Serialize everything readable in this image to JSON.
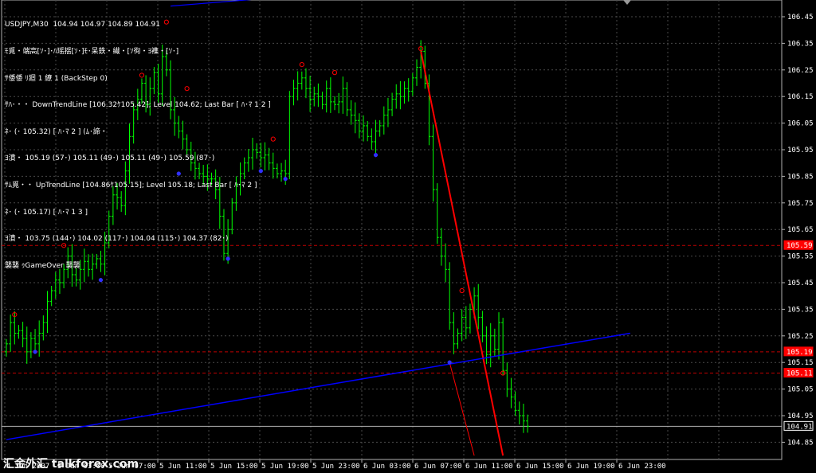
{
  "header": {
    "symbol_line": "USDJPY,M30  104.94 104.97 104.89 104.91",
    "lines": [
      "ﾓ覓・端高[ｿ･]･ﾊ瑶揺[ｿ･]ﾓ･呆鉄・繊・[ｿ徇・ﾖ襍・[ｿ･]",
      "ｻ倭倭 ﾘ廻 1 繚 1 (BackStep 0)",
      "ｻﾊ･・・ DownTrendLine [106.32ｹ105.42]; Level 104.62; Last Bar [ ﾊ･ﾏ 1 2 ]",
      "ﾈ･ (･ 105.32) [ ﾊ･ﾏ 2 ] (ﾑ･諦・",
      "ﾖ濆・ 105.19 (57･) 105.11 (49･) 105.11 (49･) 105.59 (87･)",
      "ｻﾑ覓・・ UpTrendLine [104.86ｹ105.15]; Level 105.18; Last Bar [ ﾊ･ﾏ 2 ]",
      "ﾈ･ (･ 105.17) [ ﾊ･ﾏ 1 3 ]",
      "ﾖ濆・ 103.75 (144･) 104.02 (117･) 104.04 (115･) 104.37 (82･)",
      "襲襲 ｩGameOver 襲襲"
    ]
  },
  "watermark": "汇金外汇 talkforex.com",
  "chart_data": {
    "type": "candlestick",
    "symbol": "USDJPY",
    "timeframe": "M30",
    "ylim": [
      104.8,
      106.5
    ],
    "y_ticks": [
      "106.45",
      "106.35",
      "106.25",
      "106.15",
      "106.05",
      "105.95",
      "105.85",
      "105.75",
      "105.65",
      "105.55",
      "105.45",
      "105.35",
      "105.25",
      "105.15",
      "105.05",
      "104.95",
      "104.85"
    ],
    "x_ticks": [
      "4 Jun 2007",
      "5 Jun 03:00",
      "5 Jun 07:00",
      "5 Jun 11:00",
      "5 Jun 15:00",
      "5 Jun 19:00",
      "5 Jun 23:00",
      "6 Jun 03:00",
      "6 Jun 07:00",
      "6 Jun 11:00",
      "6 Jun 15:00",
      "6 Jun 19:00",
      "6 Jun 23:00"
    ],
    "grid": true,
    "price_labels": [
      {
        "value": 105.59,
        "text": "105.59",
        "color": "#ff0000"
      },
      {
        "value": 105.19,
        "text": "105.19",
        "color": "#ff0000"
      },
      {
        "value": 105.11,
        "text": "105.11",
        "color": "#ff0000"
      },
      {
        "value": 104.91,
        "text": "104.91",
        "color": "#ffffff"
      }
    ],
    "closes": [
      105.22,
      105.3,
      105.26,
      105.27,
      105.24,
      105.19,
      105.24,
      105.22,
      105.26,
      105.3,
      105.38,
      105.42,
      105.46,
      105.45,
      105.5,
      105.55,
      105.48,
      105.46,
      105.5,
      105.53,
      105.5,
      105.52,
      105.54,
      105.52,
      105.6,
      105.7,
      105.78,
      105.77,
      105.74,
      105.87,
      106.0,
      106.1,
      106.14,
      106.2,
      106.12,
      106.18,
      106.24,
      106.16,
      106.3,
      106.25,
      106.1,
      106.05,
      106.02,
      105.99,
      105.95,
      105.9,
      105.88,
      105.86,
      105.85,
      105.84,
      105.84,
      105.8,
      105.7,
      105.56,
      105.65,
      105.75,
      105.82,
      105.86,
      105.9,
      105.92,
      105.95,
      105.94,
      105.92,
      105.93,
      105.9,
      105.88,
      105.86,
      105.87,
      105.86,
      106.15,
      106.18,
      106.2,
      106.22,
      106.18,
      106.14,
      106.16,
      106.15,
      106.12,
      106.18,
      106.13,
      106.12,
      106.13,
      106.18,
      106.1,
      106.08,
      106.06,
      106.02,
      106.04,
      106.0,
      105.98,
      106.02,
      106.04,
      106.08,
      106.1,
      106.14,
      106.16,
      106.15,
      106.18,
      106.17,
      106.22,
      106.26,
      106.32,
      106.2,
      106.0,
      105.8,
      105.62,
      105.55,
      105.5,
      105.3,
      105.22,
      105.26,
      105.32,
      105.28,
      105.35,
      105.4,
      105.32,
      105.25,
      105.18,
      105.25,
      105.2,
      105.3,
      105.12,
      105.05,
      105.02,
      104.97,
      104.95,
      104.93,
      104.91
    ],
    "swing_highs": [
      {
        "i": 2,
        "v": 105.33
      },
      {
        "i": 14,
        "v": 105.59
      },
      {
        "i": 33,
        "v": 106.23
      },
      {
        "i": 39,
        "v": 106.43
      },
      {
        "i": 44,
        "v": 106.18
      },
      {
        "i": 65,
        "v": 105.99
      },
      {
        "i": 72,
        "v": 106.27
      },
      {
        "i": 80,
        "v": 106.24
      },
      {
        "i": 101,
        "v": 106.33
      },
      {
        "i": 111,
        "v": 105.42
      },
      {
        "i": 121,
        "v": 105.11
      }
    ],
    "swing_lows": [
      {
        "i": 7,
        "v": 105.19
      },
      {
        "i": 23,
        "v": 105.46
      },
      {
        "i": 42,
        "v": 105.86
      },
      {
        "i": 54,
        "v": 105.54
      },
      {
        "i": 62,
        "v": 105.87
      },
      {
        "i": 68,
        "v": 105.84
      },
      {
        "i": 90,
        "v": 105.93
      },
      {
        "i": 108,
        "v": 105.15
      }
    ],
    "lines": [
      {
        "name": "DownTrendLine",
        "color": "#ff0000",
        "width": 2,
        "points": [
          [
            101,
            106.32
          ],
          [
            121,
            104.8
          ]
        ]
      },
      {
        "name": "DownTrendLine-thin",
        "color": "#ff0000",
        "width": 1,
        "points": [
          [
            108,
            105.15
          ],
          [
            114,
            104.8
          ]
        ]
      },
      {
        "name": "UpTrendLine",
        "color": "#0000ff",
        "width": 1.5,
        "points": [
          [
            0,
            104.86
          ],
          [
            152,
            105.26
          ]
        ]
      },
      {
        "name": "UpTrendLine-upper",
        "color": "#0000ff",
        "width": 1.2,
        "points": [
          [
            40,
            106.49
          ],
          [
            72,
            106.53
          ]
        ]
      }
    ],
    "hlines": [
      {
        "value": 105.59,
        "color": "#c00000",
        "dash": "4,3"
      },
      {
        "value": 105.19,
        "color": "#c00000",
        "dash": "4,3"
      },
      {
        "value": 105.11,
        "color": "#c00000",
        "dash": "4,3"
      },
      {
        "value": 104.91,
        "color": "#b0b0b0",
        "dash": ""
      }
    ],
    "colors": {
      "background": "#000000",
      "grid": "#4a4a4a",
      "bars": "#00ff00",
      "axis": "#b0b0b0",
      "text": "#ffffff",
      "swing_high": "#ff0000",
      "swing_low": "#3030ff"
    }
  }
}
